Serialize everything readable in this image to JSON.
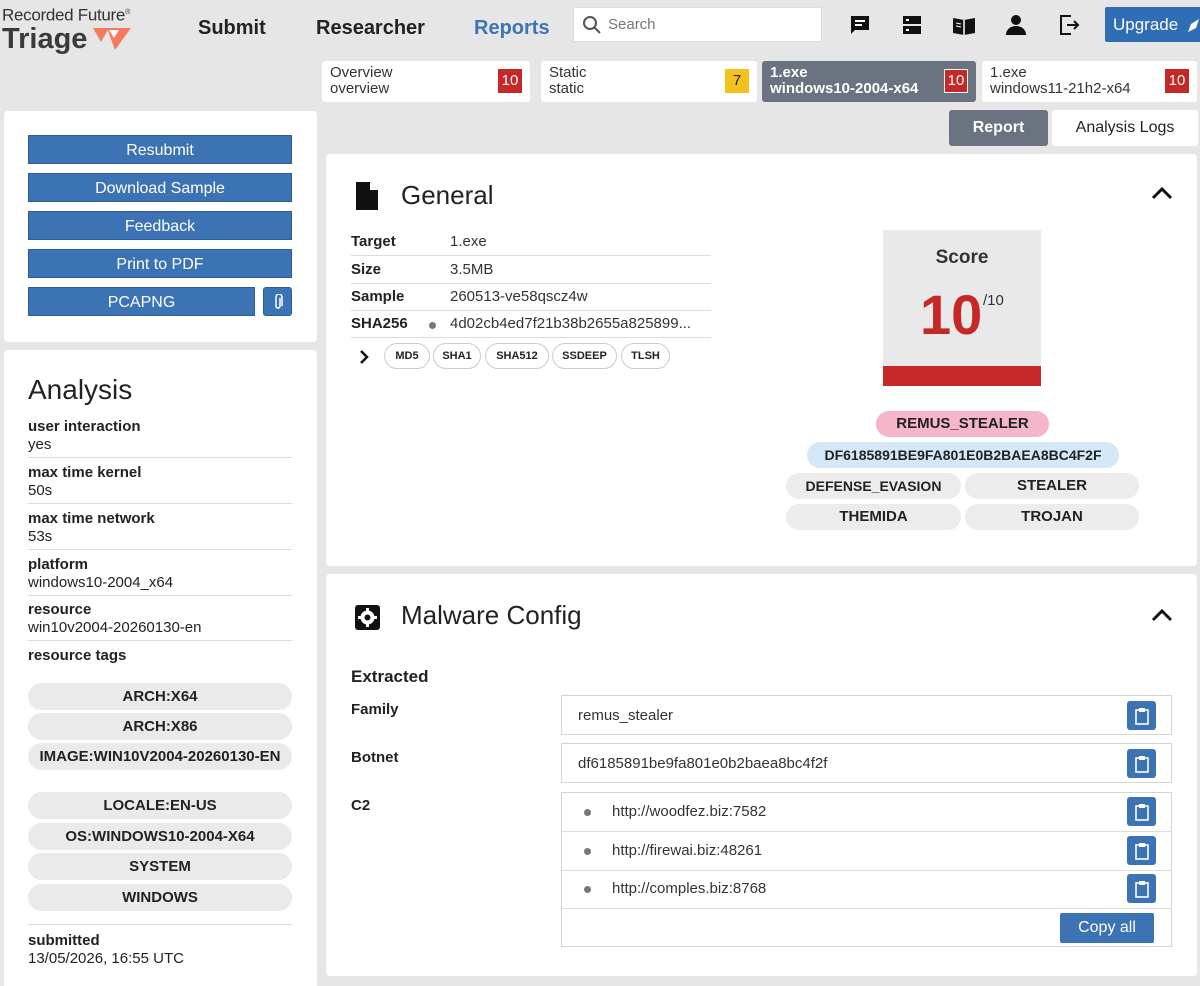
{
  "header": {
    "brand_top": "Recorded Future",
    "brand_reg": "®",
    "brand_main": "Triage",
    "nav": [
      "Submit",
      "Researcher",
      "Reports"
    ],
    "search_placeholder": "Search",
    "upgrade_label": "Upgrade"
  },
  "tabs": [
    {
      "line1": "Overview",
      "line2": "overview",
      "score": "10"
    },
    {
      "line1": "Static",
      "line2": "static",
      "score": "7"
    },
    {
      "line1": "1.exe",
      "line2": "windows10-2004-x64",
      "score": "10"
    },
    {
      "line1": "1.exe",
      "line2": "windows11-21h2-x64",
      "score": "10"
    }
  ],
  "report_tabs": {
    "report": "Report",
    "logs": "Analysis Logs"
  },
  "actions": {
    "resubmit": "Resubmit",
    "download": "Download Sample",
    "feedback": "Feedback",
    "print": "Print to PDF",
    "pcapng": "PCAPNG"
  },
  "analysis": {
    "title": "Analysis",
    "items": [
      {
        "k": "user interaction",
        "v": "yes"
      },
      {
        "k": "max time kernel",
        "v": "50s"
      },
      {
        "k": "max time network",
        "v": "53s"
      },
      {
        "k": "platform",
        "v": "windows10-2004_x64"
      },
      {
        "k": "resource",
        "v": "win10v2004-20260130-en"
      }
    ],
    "tags_label": "resource tags",
    "tags": [
      "ARCH:X64",
      "ARCH:X86",
      "IMAGE:WIN10V2004-20260130-EN",
      "LOCALE:EN-US",
      "OS:WINDOWS10-2004-X64",
      "SYSTEM",
      "WINDOWS"
    ],
    "submitted_label": "submitted",
    "submitted_value": "13/05/2026, 16:55 UTC"
  },
  "general": {
    "title": "General",
    "rows": [
      {
        "k": "Target",
        "v": "1.exe"
      },
      {
        "k": "Size",
        "v": "3.5MB"
      },
      {
        "k": "Sample",
        "v": "260513-ve58qscz4w"
      },
      {
        "k": "SHA256",
        "v": "4d02cb4ed7f21b38b2655a825899..."
      }
    ],
    "hashes": [
      "MD5",
      "SHA1",
      "SHA512",
      "SSDEEP",
      "TLSH"
    ],
    "score_label": "Score",
    "score": "10",
    "score_max": "/10",
    "family_tag": "REMUS_STEALER",
    "botnet_tag": "DF6185891BE9FA801E0B2BAEA8BC4F2F",
    "tags": [
      "DEFENSE_EVASION",
      "STEALER",
      "THEMIDA",
      "TROJAN"
    ],
    "colors": {
      "family_tag": "#f4b6c8",
      "botnet_tag": "#d4e8f8",
      "plain_tag": "#ececec",
      "score_red": "#c62828"
    }
  },
  "config": {
    "title": "Malware Config",
    "extracted": "Extracted",
    "family_label": "Family",
    "family": "remus_stealer",
    "botnet_label": "Botnet",
    "botnet": "df6185891be9fa801e0b2baea8bc4f2f",
    "c2_label": "C2",
    "c2": [
      "http://woodfez.biz:7582",
      "http://firewai.biz:48261",
      "http://comples.biz:8768"
    ],
    "copy_all": "Copy all"
  },
  "colors": {
    "accent": "#3b73b5",
    "nav_active": "#3d74b3",
    "tab_active": "#6b7280",
    "badge_red": "#c62828",
    "badge_yellow": "#f4c21f"
  }
}
